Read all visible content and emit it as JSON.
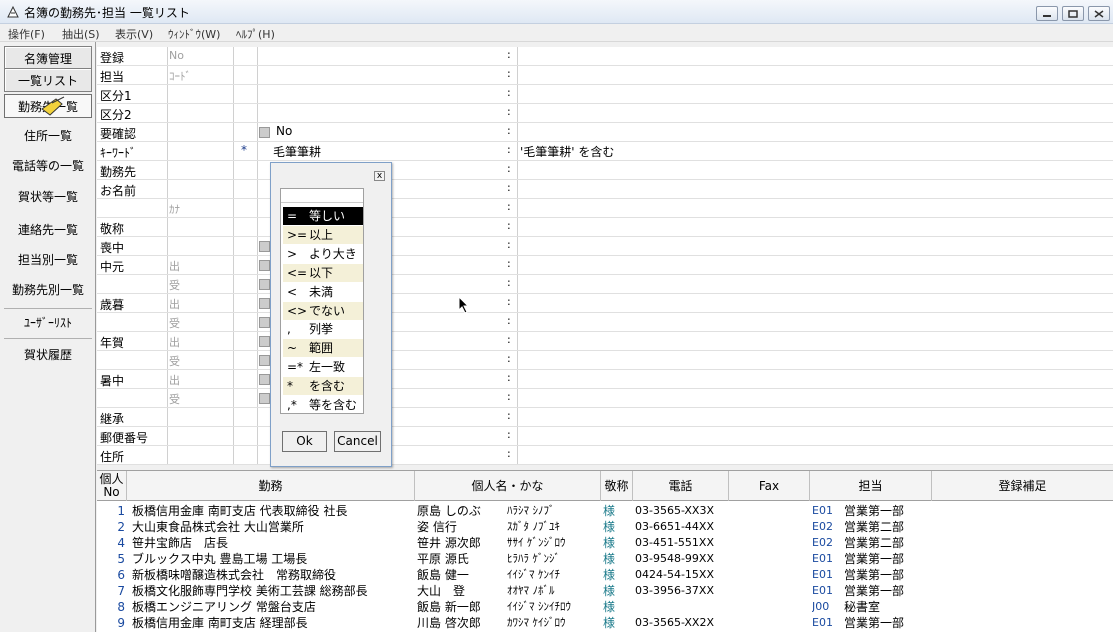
{
  "window": {
    "title": "名簿の勤務先･担当 一覧リスト"
  },
  "menu": [
    "操作(F)",
    "抽出(S)",
    "表示(V)",
    "ｳｨﾝﾄﾞｳ(W)",
    "ﾍﾙﾌﾟ(H)"
  ],
  "sidebar": {
    "items": [
      "名簿管理",
      "一覧リスト",
      "勤務先一覧",
      "住所一覧",
      "電話等の一覧",
      "賀状等一覧",
      "連絡先一覧",
      "担当別一覧",
      "勤務先別一覧",
      "ﾕｰｻﾞｰﾘｽﾄ",
      "賀状履歴"
    ]
  },
  "form": {
    "rows": [
      {
        "label": "登録",
        "sub": "No",
        "op": "",
        "value": "",
        "cond": ""
      },
      {
        "label": "担当",
        "sub": "ｺｰﾄﾞ",
        "op": "",
        "value": "",
        "cond": ""
      },
      {
        "label": "区分1",
        "sub": "",
        "op": "",
        "value": "",
        "cond": ""
      },
      {
        "label": "区分2",
        "sub": "",
        "op": "",
        "value": "",
        "cond": ""
      },
      {
        "label": "要確認",
        "sub": "",
        "op": "",
        "value": "No",
        "cond": ""
      },
      {
        "label": "ｷｰﾜｰﾄﾞ",
        "sub": "",
        "op": "*",
        "value": "毛筆筆耕",
        "cond": "'毛筆筆耕' を含む"
      },
      {
        "label": "勤務先",
        "sub": "",
        "op": "",
        "value": "",
        "cond": ""
      },
      {
        "label": "お名前",
        "sub": "",
        "op": "",
        "value": "",
        "cond": ""
      },
      {
        "label": "",
        "sub": "ｶﾅ",
        "op": "",
        "value": "",
        "cond": ""
      },
      {
        "label": "敬称",
        "sub": "",
        "op": "",
        "value": "",
        "cond": ""
      },
      {
        "label": "喪中",
        "sub": "",
        "op": "",
        "value": "",
        "cond": ""
      },
      {
        "label": "中元",
        "sub": "出",
        "op": "",
        "value": "",
        "cond": ""
      },
      {
        "label": "",
        "sub": "受",
        "op": "",
        "value": "",
        "cond": ""
      },
      {
        "label": "歳暮",
        "sub": "出",
        "op": "",
        "value": "",
        "cond": ""
      },
      {
        "label": "",
        "sub": "受",
        "op": "",
        "value": "",
        "cond": ""
      },
      {
        "label": "年賀",
        "sub": "出",
        "op": "",
        "value": "",
        "cond": ""
      },
      {
        "label": "",
        "sub": "受",
        "op": "",
        "value": "",
        "cond": ""
      },
      {
        "label": "暑中",
        "sub": "出",
        "op": "",
        "value": "",
        "cond": ""
      },
      {
        "label": "",
        "sub": "受",
        "op": "",
        "value": "",
        "cond": ""
      },
      {
        "label": "継承",
        "sub": "",
        "op": "",
        "value": "",
        "cond": ""
      },
      {
        "label": "郵便番号",
        "sub": "",
        "op": "",
        "value": "",
        "cond": ""
      },
      {
        "label": "住所",
        "sub": "",
        "op": "",
        "value": "",
        "cond": ""
      }
    ]
  },
  "dialog": {
    "close": "x",
    "options": [
      {
        "sym": "=",
        "label": "等しい"
      },
      {
        "sym": ">=",
        "label": "以上"
      },
      {
        "sym": ">",
        "label": "より大きい"
      },
      {
        "sym": "<=",
        "label": "以下"
      },
      {
        "sym": "<",
        "label": "未満"
      },
      {
        "sym": "<>",
        "label": "でない"
      },
      {
        "sym": ",",
        "label": "列挙"
      },
      {
        "sym": "~",
        "label": "範囲"
      },
      {
        "sym": "=*",
        "label": "左一致"
      },
      {
        "sym": "*",
        "label": "を含む"
      },
      {
        "sym": ",*",
        "label": "等を含む"
      }
    ],
    "ok": "Ok",
    "cancel": "Cancel"
  },
  "table": {
    "headers": {
      "no": "個人\nNo",
      "kinmu": "勤務",
      "name": "個人名・かな",
      "keisho": "敬称",
      "tel": "電話",
      "fax": "Fax",
      "tanto": "担当",
      "hosoku": "登録補足"
    },
    "rows": [
      {
        "no": "1",
        "kinmu": "板橋信用金庫 南町支店 代表取締役 社長",
        "name": "原島 しのぶ",
        "kana": "ﾊﾗｼﾏ ｼﾉﾌﾞ",
        "keisho": "様",
        "tel": "03-3565-XX3X",
        "code": "E01",
        "dept": "営業第一部"
      },
      {
        "no": "2",
        "kinmu": "大山東食品株式会社 大山営業所",
        "name": "姿 信行",
        "kana": "ｽｶﾞﾀ ﾉﾌﾞﾕｷ",
        "keisho": "様",
        "tel": "03-6651-44XX",
        "code": "E02",
        "dept": "営業第二部"
      },
      {
        "no": "4",
        "kinmu": "笹井宝飾店　店長",
        "name": "笹井 源次郎",
        "kana": "ｻｻｲ ｹﾞﾝｼﾞﾛｳ",
        "keisho": "様",
        "tel": "03-451-551XX",
        "code": "E02",
        "dept": "営業第二部"
      },
      {
        "no": "5",
        "kinmu": "ブルックス中丸 豊島工場 工場長",
        "name": "平原 源氏",
        "kana": "ﾋﾗﾊﾗ ｹﾞﾝｼﾞ",
        "keisho": "様",
        "tel": "03-9548-99XX",
        "code": "E01",
        "dept": "営業第一部"
      },
      {
        "no": "6",
        "kinmu": "新板橋味噌醸造株式会社　常務取締役",
        "name": "飯島 健一",
        "kana": "ｲｲｼﾞﾏ ｹﾝｲﾁ",
        "keisho": "様",
        "tel": "0424-54-15XX",
        "code": "E01",
        "dept": "営業第一部"
      },
      {
        "no": "7",
        "kinmu": "板橋文化服飾専門学校 美術工芸課 総務部長",
        "name": "大山　登",
        "kana": "ｵｵﾔﾏ ﾉﾎﾞﾙ",
        "keisho": "様",
        "tel": "03-3956-37XX",
        "code": "E01",
        "dept": "営業第一部"
      },
      {
        "no": "8",
        "kinmu": "板橋エンジニアリング 常盤台支店",
        "name": "飯島 新一郎",
        "kana": "ｲｲｼﾞﾏ ｼﾝｲﾁﾛｳ",
        "keisho": "様",
        "tel": "",
        "code": "J00",
        "dept": "秘書室"
      },
      {
        "no": "9",
        "kinmu": "板橋信用金庫 南町支店 経理部長",
        "name": "川島 啓次郎",
        "kana": "ｶﾜｼﾏ ｹｲｼﾞﾛｳ",
        "keisho": "様",
        "tel": "03-3565-XX2X",
        "code": "E01",
        "dept": "営業第一部"
      }
    ]
  }
}
